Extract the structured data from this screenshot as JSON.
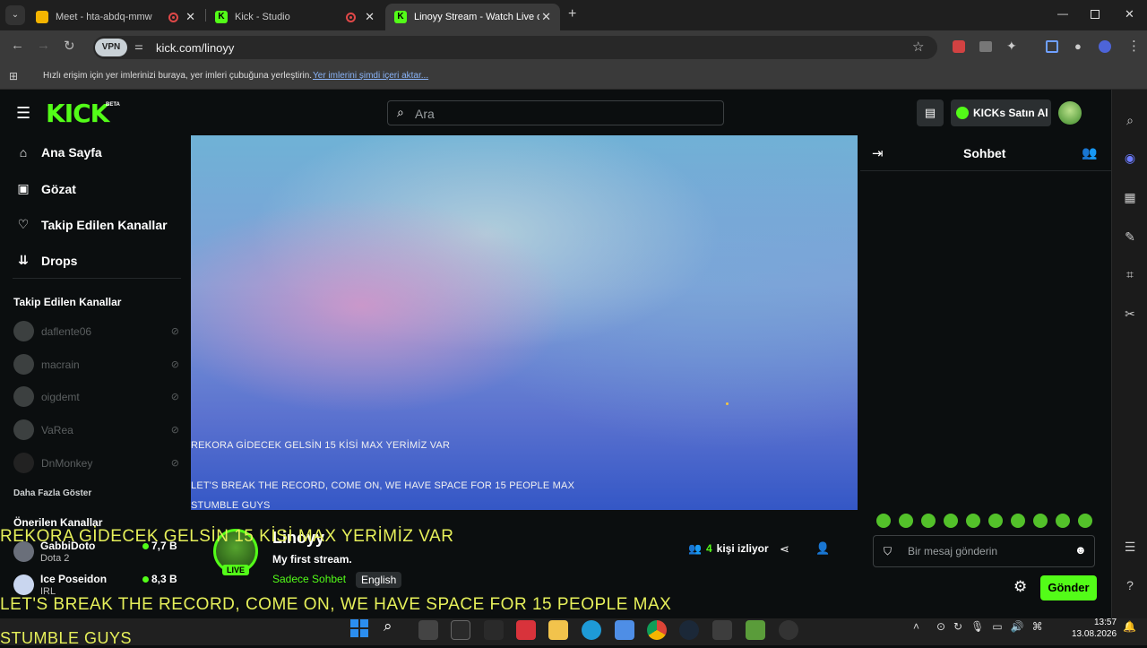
{
  "tabs": [
    {
      "title": "Meet - hta-abdq-mmw"
    },
    {
      "title": "Kick - Studio"
    },
    {
      "title": "Linoyy Stream - Watch Live on K"
    }
  ],
  "address": {
    "url": "kick.com/linoyy",
    "vpn": "VPN"
  },
  "bookmarks": {
    "text": "Hızlı erişim için yer imlerinizi buraya, yer imleri çubuğuna yerleştirin.",
    "link": "Yer imlerini şimdi içeri aktar..."
  },
  "header": {
    "logo": "KICK",
    "beta": "BETA",
    "search_placeholder": "Ara",
    "buy_kicks": "KICKs Satın Al"
  },
  "sidebar": {
    "nav": [
      {
        "label": "Ana Sayfa",
        "icon": "home-icon"
      },
      {
        "label": "Gözat",
        "icon": "browse-icon"
      },
      {
        "label": "Takip Edilen Kanallar",
        "icon": "heart-icon"
      },
      {
        "label": "Drops",
        "icon": "drops-icon"
      }
    ],
    "followed_title": "Takip Edilen Kanallar",
    "followed": [
      {
        "name": "daflente06"
      },
      {
        "name": "macrain"
      },
      {
        "name": "oigdemt"
      },
      {
        "name": "VaRea"
      },
      {
        "name": "DnMonkey"
      }
    ],
    "show_more": "Daha Fazla Göster",
    "recommended_title": "Önerilen Kanallar",
    "recommended": [
      {
        "name": "GabbiDoto",
        "category": "Dota 2",
        "viewers": "7,7 B"
      },
      {
        "name": "Ice Poseidon",
        "category": "IRL",
        "viewers": "8,3 B"
      }
    ]
  },
  "video": {
    "caption1": "REKORA GİDECEK GELSİN 15 KİSİ MAX YERİMİZ VAR",
    "caption2": "LET'S BREAK THE RECORD, COME ON, WE HAVE SPACE FOR 15 PEOPLE MAX",
    "caption3": "STUMBLE GUYS"
  },
  "overlay": {
    "line1": "REKORA GİDECEK GELSİN 15 KİSİ MAX YERİMİZ VAR",
    "line2": "LET'S BREAK THE RECORD, COME ON, WE HAVE SPACE FOR 15 PEOPLE MAX",
    "line3": "STUMBLE GUYS"
  },
  "stream": {
    "channel": "Linoyy",
    "live_badge": "LIVE",
    "title": "My first stream.",
    "category": "Sadece Sohbet",
    "language": "English",
    "viewer_count": "4",
    "viewer_label": "kişi izliyor"
  },
  "chat": {
    "title": "Sohbet",
    "input_placeholder": "Bir mesaj gönderin",
    "send": "Gönder"
  },
  "taskbar": {
    "time": "13:57",
    "date": "13.08.2026"
  },
  "colors": {
    "kick_green": "#53fc18",
    "bg": "#0b0e0f",
    "overlay_text": "#e6f05a"
  }
}
